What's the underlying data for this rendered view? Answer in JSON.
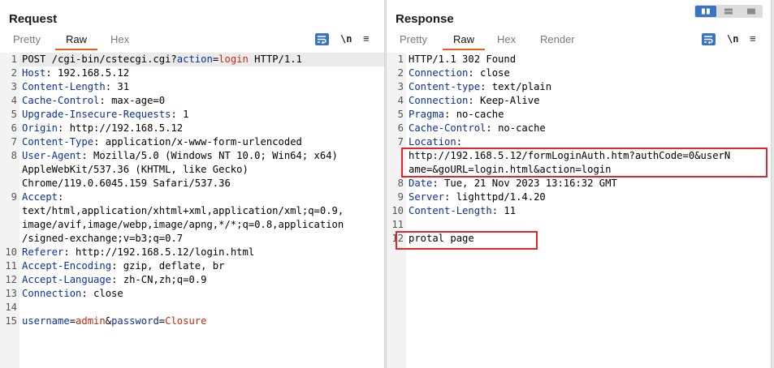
{
  "request": {
    "title": "Request",
    "tabs": [
      {
        "label": "Pretty",
        "active": false
      },
      {
        "label": "Raw",
        "active": true
      },
      {
        "label": "Hex",
        "active": false
      }
    ],
    "toolbar": {
      "newline_label": "\\n",
      "wrap_icon": "wrap-lines-icon",
      "menu_icon": "hamburger-menu-icon",
      "menu_glyph": "≡"
    },
    "lines": [
      {
        "n": "1",
        "parts": [
          {
            "t": "POST /cgi-bin/cstecgi.cgi?",
            "c": "plain"
          },
          {
            "t": "action",
            "c": "pname"
          },
          {
            "t": "=",
            "c": "plain"
          },
          {
            "t": "login",
            "c": "pval"
          },
          {
            "t": " HTTP/1.1",
            "c": "plain"
          }
        ]
      },
      {
        "n": "2",
        "parts": [
          {
            "t": "Host",
            "c": "hdr"
          },
          {
            "t": ": 192.168.5.12",
            "c": "plain"
          }
        ]
      },
      {
        "n": "3",
        "parts": [
          {
            "t": "Content-Length",
            "c": "hdr"
          },
          {
            "t": ": 31",
            "c": "plain"
          }
        ]
      },
      {
        "n": "4",
        "parts": [
          {
            "t": "Cache-Control",
            "c": "hdr"
          },
          {
            "t": ": max-age=0",
            "c": "plain"
          }
        ]
      },
      {
        "n": "5",
        "parts": [
          {
            "t": "Upgrade-Insecure-Requests",
            "c": "hdr"
          },
          {
            "t": ": 1",
            "c": "plain"
          }
        ]
      },
      {
        "n": "6",
        "parts": [
          {
            "t": "Origin",
            "c": "hdr"
          },
          {
            "t": ": http://192.168.5.12",
            "c": "plain"
          }
        ]
      },
      {
        "n": "7",
        "parts": [
          {
            "t": "Content-Type",
            "c": "hdr"
          },
          {
            "t": ": application/x-www-form-urlencoded",
            "c": "plain"
          }
        ]
      },
      {
        "n": "8",
        "parts": [
          {
            "t": "User-Agent",
            "c": "hdr"
          },
          {
            "t": ": Mozilla/5.0 (Windows NT 10.0; Win64; x64)",
            "c": "plain"
          }
        ]
      },
      {
        "n": "",
        "parts": [
          {
            "t": "AppleWebKit/537.36 (KHTML, like Gecko)",
            "c": "plain"
          }
        ]
      },
      {
        "n": "",
        "parts": [
          {
            "t": "Chrome/119.0.6045.159 Safari/537.36",
            "c": "plain"
          }
        ]
      },
      {
        "n": "9",
        "parts": [
          {
            "t": "Accept",
            "c": "hdr"
          },
          {
            "t": ":",
            "c": "plain"
          }
        ]
      },
      {
        "n": "",
        "parts": [
          {
            "t": "text/html,application/xhtml+xml,application/xml;q=0.9,",
            "c": "plain"
          }
        ]
      },
      {
        "n": "",
        "parts": [
          {
            "t": "image/avif,image/webp,image/apng,*/*;q=0.8,application",
            "c": "plain"
          }
        ]
      },
      {
        "n": "",
        "parts": [
          {
            "t": "/signed-exchange;v=b3;q=0.7",
            "c": "plain"
          }
        ]
      },
      {
        "n": "10",
        "parts": [
          {
            "t": "Referer",
            "c": "hdr"
          },
          {
            "t": ": http://192.168.5.12/login.html",
            "c": "plain"
          }
        ]
      },
      {
        "n": "11",
        "parts": [
          {
            "t": "Accept-Encoding",
            "c": "hdr"
          },
          {
            "t": ": gzip, deflate, br",
            "c": "plain"
          }
        ]
      },
      {
        "n": "12",
        "parts": [
          {
            "t": "Accept-Language",
            "c": "hdr"
          },
          {
            "t": ": zh-CN,zh;q=0.9",
            "c": "plain"
          }
        ]
      },
      {
        "n": "13",
        "parts": [
          {
            "t": "Connection",
            "c": "hdr"
          },
          {
            "t": ": close",
            "c": "plain"
          }
        ]
      },
      {
        "n": "14",
        "parts": []
      },
      {
        "n": "15",
        "parts": [
          {
            "t": "username",
            "c": "pname"
          },
          {
            "t": "=",
            "c": "plain"
          },
          {
            "t": "admin",
            "c": "pval"
          },
          {
            "t": "&",
            "c": "plain"
          },
          {
            "t": "password",
            "c": "pname"
          },
          {
            "t": "=",
            "c": "plain"
          },
          {
            "t": "Closure",
            "c": "pval"
          }
        ]
      }
    ]
  },
  "response": {
    "title": "Response",
    "tabs": [
      {
        "label": "Pretty",
        "active": false
      },
      {
        "label": "Raw",
        "active": true
      },
      {
        "label": "Hex",
        "active": false
      },
      {
        "label": "Render",
        "active": false
      }
    ],
    "toolbar": {
      "newline_label": "\\n",
      "wrap_icon": "wrap-lines-icon",
      "menu_icon": "hamburger-menu-icon",
      "menu_glyph": "≡"
    },
    "lines": [
      {
        "n": "1",
        "parts": [
          {
            "t": "HTTP/1.1 302 Found",
            "c": "plain"
          }
        ]
      },
      {
        "n": "2",
        "parts": [
          {
            "t": "Connection",
            "c": "hdr"
          },
          {
            "t": ": close",
            "c": "plain"
          }
        ]
      },
      {
        "n": "3",
        "parts": [
          {
            "t": "Content-type",
            "c": "hdr"
          },
          {
            "t": ": text/plain",
            "c": "plain"
          }
        ]
      },
      {
        "n": "4",
        "parts": [
          {
            "t": "Connection",
            "c": "hdr"
          },
          {
            "t": ": Keep-Alive",
            "c": "plain"
          }
        ]
      },
      {
        "n": "5",
        "parts": [
          {
            "t": "Pragma",
            "c": "hdr"
          },
          {
            "t": ": no-cache",
            "c": "plain"
          }
        ]
      },
      {
        "n": "6",
        "parts": [
          {
            "t": "Cache-Control",
            "c": "hdr"
          },
          {
            "t": ": no-cache",
            "c": "plain"
          }
        ]
      },
      {
        "n": "7",
        "parts": [
          {
            "t": "Location",
            "c": "hdr"
          },
          {
            "t": ":",
            "c": "plain"
          }
        ]
      },
      {
        "n": "",
        "parts": [
          {
            "t": "http://192.168.5.12/formLoginAuth.htm?authCode=0&userN",
            "c": "plain"
          }
        ]
      },
      {
        "n": "",
        "parts": [
          {
            "t": "ame=&goURL=login.html&action=login",
            "c": "plain"
          }
        ]
      },
      {
        "n": "8",
        "parts": [
          {
            "t": "Date",
            "c": "hdr"
          },
          {
            "t": ": Tue, 21 Nov 2023 13:16:32 GMT",
            "c": "plain"
          }
        ]
      },
      {
        "n": "9",
        "parts": [
          {
            "t": "Server",
            "c": "hdr"
          },
          {
            "t": ": lighttpd/1.4.20",
            "c": "plain"
          }
        ]
      },
      {
        "n": "10",
        "parts": [
          {
            "t": "Content-Length",
            "c": "hdr"
          },
          {
            "t": ": 11",
            "c": "plain"
          }
        ]
      },
      {
        "n": "11",
        "parts": []
      },
      {
        "n": "12",
        "parts": [
          {
            "t": "protal page",
            "c": "plain"
          }
        ]
      }
    ]
  },
  "colors": {
    "accent": "#e8601c",
    "header_name": "#0a2f9a",
    "param_value": "#c22a14",
    "highlight_box": "#e0282c",
    "button_blue": "#3c74c4"
  }
}
